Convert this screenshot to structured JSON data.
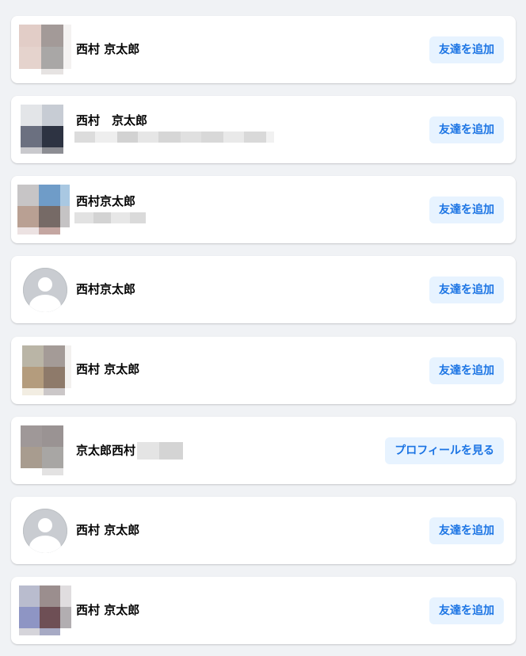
{
  "results": [
    {
      "name": "西村 京太郎",
      "button": "友達を追加",
      "avatar": "photo"
    },
    {
      "name": "西村　京太郎",
      "button": "友達を追加",
      "avatar": "photo"
    },
    {
      "name": "西村京太郎",
      "button": "友達を追加",
      "avatar": "photo"
    },
    {
      "name": "西村京太郎",
      "button": "友達を追加",
      "avatar": "default-silhouette-icon"
    },
    {
      "name": "西村 京太郎",
      "button": "友達を追加",
      "avatar": "photo"
    },
    {
      "name": "京太郎西村",
      "button": "プロフィールを見る",
      "avatar": "photo"
    },
    {
      "name": "西村 京太郎",
      "button": "友達を追加",
      "avatar": "default-silhouette-icon"
    },
    {
      "name": "西村 京太郎",
      "button": "友達を追加",
      "avatar": "photo"
    }
  ],
  "colors": {
    "page_background": "#f0f2f5",
    "card_background": "#ffffff",
    "button_background": "#e7f3ff",
    "button_text": "#1b74e4",
    "name_text": "#050505"
  }
}
